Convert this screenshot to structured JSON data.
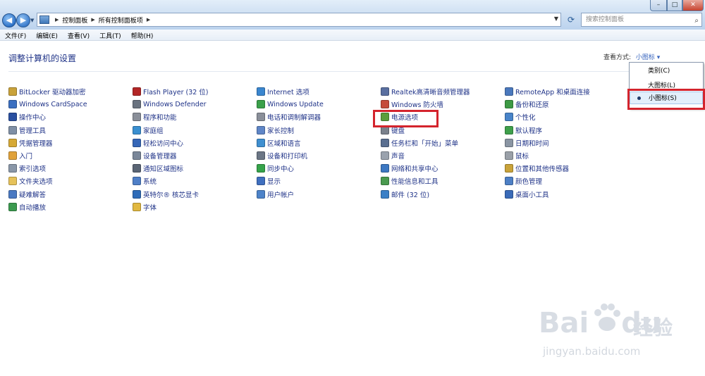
{
  "address": {
    "crumbs": [
      "控制面板",
      "所有控制面板项"
    ],
    "search_placeholder": "搜索控制面板"
  },
  "menu": [
    "文件(F)",
    "编辑(E)",
    "查看(V)",
    "工具(T)",
    "帮助(H)"
  ],
  "header": {
    "title": "调整计算机的设置",
    "viewby_label": "查看方式:",
    "viewby_value": "小图标 ▾"
  },
  "dropdown": {
    "options": [
      "类别(C)",
      "大图标(L)",
      "小图标(S)"
    ],
    "selected_index": 2
  },
  "columns": [
    [
      {
        "label": "BitLocker 驱动器加密",
        "color": "#c9a23a"
      },
      {
        "label": "Windows CardSpace",
        "color": "#3b6fc0"
      },
      {
        "label": "操作中心",
        "color": "#2a4fa0"
      },
      {
        "label": "管理工具",
        "color": "#7f8fa5"
      },
      {
        "label": "凭据管理器",
        "color": "#d6a935"
      },
      {
        "label": "入门",
        "color": "#e0a23a"
      },
      {
        "label": "索引选项",
        "color": "#8a97a8"
      },
      {
        "label": "文件夹选项",
        "color": "#e6c25a"
      },
      {
        "label": "疑难解答",
        "color": "#4a79c2"
      },
      {
        "label": "自动播放",
        "color": "#3b9a4f"
      }
    ],
    [
      {
        "label": "Flash Player (32 位)",
        "color": "#b32626"
      },
      {
        "label": "Windows Defender",
        "color": "#6a7380"
      },
      {
        "label": "程序和功能",
        "color": "#8a8f99"
      },
      {
        "label": "家庭组",
        "color": "#3a8fd0"
      },
      {
        "label": "轻松访问中心",
        "color": "#3667b8"
      },
      {
        "label": "设备管理器",
        "color": "#7a8799"
      },
      {
        "label": "通知区域图标",
        "color": "#5a6575"
      },
      {
        "label": "系统",
        "color": "#4f7fc7"
      },
      {
        "label": "英特尔® 核芯显卡",
        "color": "#2f6cb8"
      },
      {
        "label": "字体",
        "color": "#e1b840"
      }
    ],
    [
      {
        "label": "Internet 选项",
        "color": "#3a86cf"
      },
      {
        "label": "Windows Update",
        "color": "#3aa04a"
      },
      {
        "label": "电话和调制解调器",
        "color": "#8a8f99"
      },
      {
        "label": "家长控制",
        "color": "#5f86c7"
      },
      {
        "label": "区域和语言",
        "color": "#3f8fd0"
      },
      {
        "label": "设备和打印机",
        "color": "#6b7685"
      },
      {
        "label": "同步中心",
        "color": "#35a34a"
      },
      {
        "label": "显示",
        "color": "#3f6fbf"
      },
      {
        "label": "用户帐户",
        "color": "#4d83c9"
      }
    ],
    [
      {
        "label": "Realtek高清晰音频管理器",
        "color": "#5a6fa0"
      },
      {
        "label": "Windows 防火墙",
        "color": "#c54a3a"
      },
      {
        "label": "电源选项",
        "color": "#5c9e3c"
      },
      {
        "label": "键盘",
        "color": "#7a818c"
      },
      {
        "label": "任务栏和「开始」菜单",
        "color": "#5a6f90"
      },
      {
        "label": "声音",
        "color": "#9aa2ad"
      },
      {
        "label": "网络和共享中心",
        "color": "#3d78c2"
      },
      {
        "label": "性能信息和工具",
        "color": "#4a9a4f"
      },
      {
        "label": "邮件 (32 位)",
        "color": "#3a7fc6"
      }
    ],
    [
      {
        "label": "RemoteApp 和桌面连接",
        "color": "#4a78bd"
      },
      {
        "label": "备份和还原",
        "color": "#3d9a44"
      },
      {
        "label": "个性化",
        "color": "#4884c9"
      },
      {
        "label": "默认程序",
        "color": "#3fa04b"
      },
      {
        "label": "日期和时间",
        "color": "#8a95a3"
      },
      {
        "label": "鼠标",
        "color": "#9aa0a8"
      },
      {
        "label": "位置和其他传感器",
        "color": "#c9a33a"
      },
      {
        "label": "颜色管理",
        "color": "#4d7fc5"
      },
      {
        "label": "桌面小工具",
        "color": "#3a6bb8"
      }
    ]
  ],
  "watermark": {
    "brand": "Bai",
    "brand_tail": "du",
    "cn": "经验",
    "url": "jingyan.baidu.com"
  }
}
